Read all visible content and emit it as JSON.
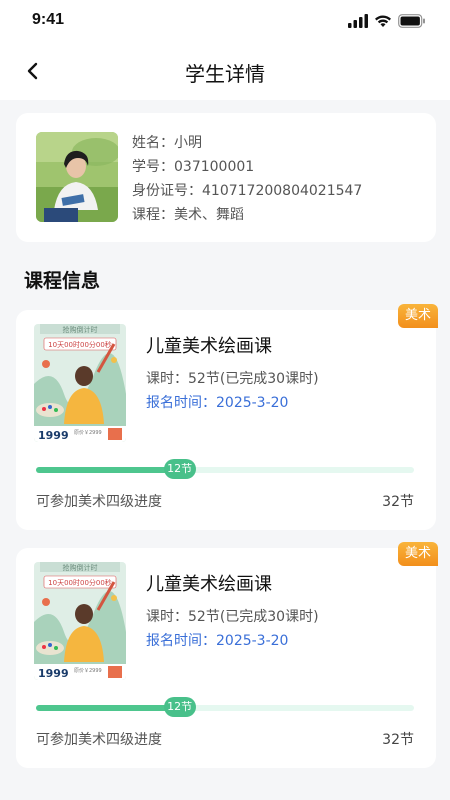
{
  "status_bar": {
    "time": "9:41"
  },
  "nav": {
    "title": "学生详情"
  },
  "student": {
    "name_line": "姓名：小明",
    "student_no_line": "学号：037100001",
    "id_line": "身份证号：410717200804021547",
    "courses_line": "课程：美术、舞蹈"
  },
  "section": {
    "title": "课程信息"
  },
  "courses": [
    {
      "tag": "美术",
      "name": "儿童美术绘画课",
      "hours": "课时：52节(已完成30课时)",
      "enroll": "报名时间：2025-3-20",
      "progress_label": "12节",
      "progress_fraction": 0.38,
      "progress_desc": "可参加美术四级进度",
      "total": "32节",
      "thumb": {
        "top": "抢购倒计时",
        "countdown": "10天00时00分00秒",
        "price": "1999",
        "orig": "原价￥2999"
      }
    },
    {
      "tag": "美术",
      "name": "儿童美术绘画课",
      "hours": "课时：52节(已完成30课时)",
      "enroll": "报名时间：2025-3-20",
      "progress_label": "12节",
      "progress_fraction": 0.38,
      "progress_desc": "可参加美术四级进度",
      "total": "32节",
      "thumb": {
        "top": "抢购倒计时",
        "countdown": "10天00时00分00秒",
        "price": "1999",
        "orig": "原价￥2999"
      }
    }
  ],
  "colors": {
    "accent": "#4ec68e",
    "tag": "#f5a623",
    "link": "#3a6fd8"
  }
}
